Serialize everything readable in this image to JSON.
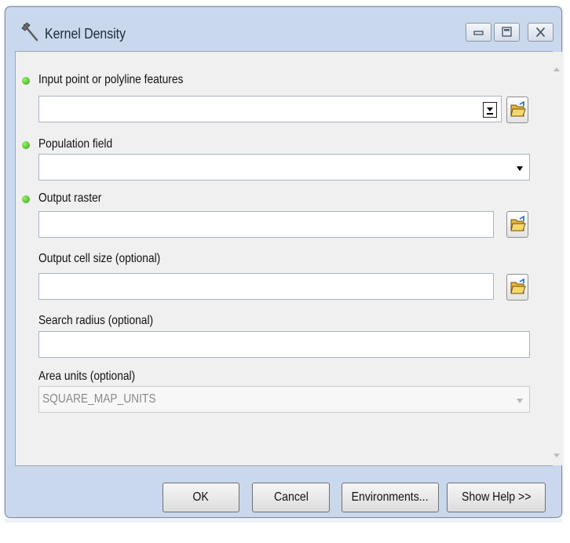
{
  "window": {
    "title": "Kernel Density",
    "title_icon": "hammer-icon",
    "controls": [
      "minimize-icon",
      "maximize-icon",
      "close-icon"
    ]
  },
  "form": {
    "input_features": {
      "label": "Input point or polyline features",
      "value": "",
      "required": true
    },
    "population_field": {
      "label": "Population field",
      "value": "",
      "required": true
    },
    "output_raster": {
      "label": "Output raster",
      "value": "",
      "required": true
    },
    "cell_size": {
      "label": "Output cell size (optional)",
      "value": ""
    },
    "search_radius": {
      "label": "Search radius (optional)",
      "value": ""
    },
    "area_units": {
      "label": "Area units (optional)",
      "value": "SQUARE_MAP_UNITS",
      "disabled": true
    }
  },
  "buttons": {
    "ok": "OK",
    "cancel": "Cancel",
    "environments": "Environments...",
    "show_help": "Show Help >>"
  },
  "colors": {
    "required_bullet": "#33b01a",
    "frame": "#c9d8ec",
    "client": "#f0f0f0"
  }
}
